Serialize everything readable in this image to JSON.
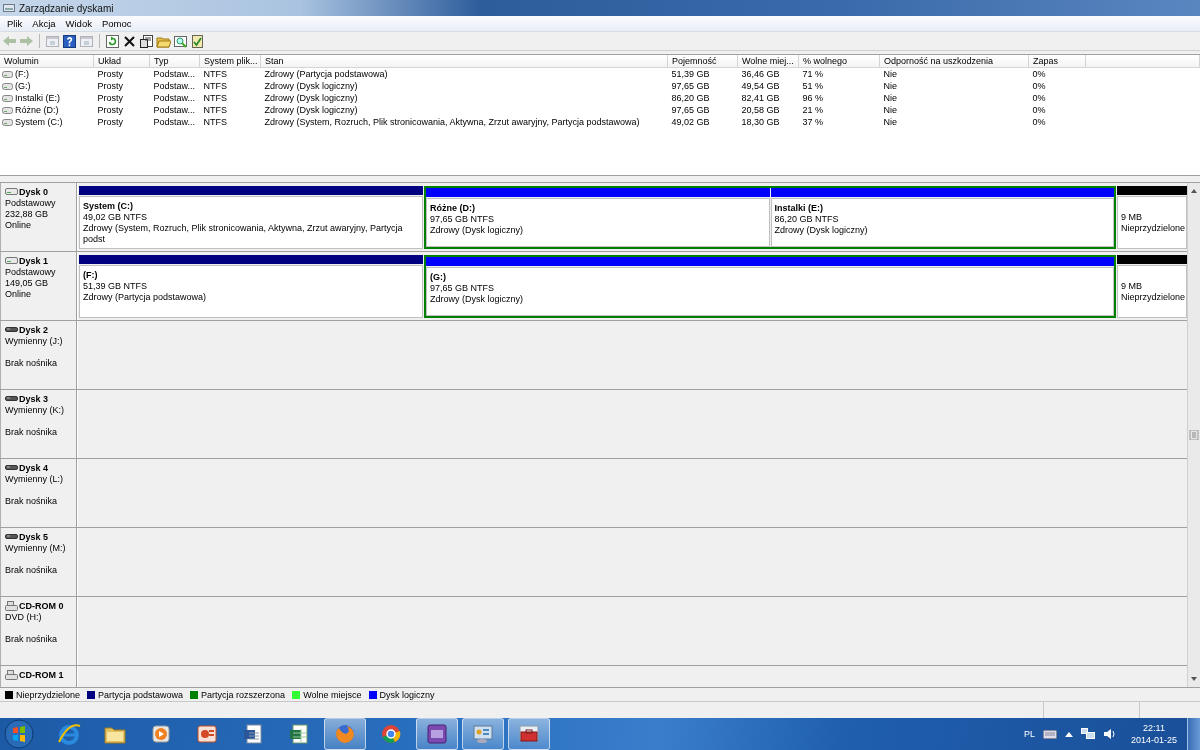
{
  "window": {
    "title": "Zarządzanie dyskami"
  },
  "menu": [
    "Plik",
    "Akcja",
    "Widok",
    "Pomoc"
  ],
  "toolbar": [
    {
      "kind": "back",
      "disabled": true
    },
    {
      "kind": "forward",
      "disabled": true
    },
    {
      "kind": "sep"
    },
    {
      "kind": "pane",
      "disabled": true
    },
    {
      "kind": "help",
      "disabled": false
    },
    {
      "kind": "pane",
      "disabled": true
    },
    {
      "kind": "sep"
    },
    {
      "kind": "refresh",
      "disabled": false
    },
    {
      "kind": "delete",
      "disabled": false
    },
    {
      "kind": "properties",
      "disabled": false
    },
    {
      "kind": "folder",
      "disabled": false
    },
    {
      "kind": "search",
      "disabled": false
    },
    {
      "kind": "check",
      "disabled": false
    }
  ],
  "volumes": {
    "columns": [
      "Wolumin",
      "Układ",
      "Typ",
      "System plik...",
      "Stan",
      "Pojemność",
      "Wolne miej...",
      "% wolnego",
      "Odporność na uszkodzenia",
      "Zapas"
    ],
    "rows": [
      [
        "(F:)",
        "Prosty",
        "Podstaw...",
        "NTFS",
        "Zdrowy (Partycja podstawowa)",
        "51,39 GB",
        "36,46 GB",
        "71 %",
        "Nie",
        "0%"
      ],
      [
        "(G:)",
        "Prosty",
        "Podstaw...",
        "NTFS",
        "Zdrowy (Dysk logiczny)",
        "97,65 GB",
        "49,54 GB",
        "51 %",
        "Nie",
        "0%"
      ],
      [
        "Instalki (E:)",
        "Prosty",
        "Podstaw...",
        "NTFS",
        "Zdrowy (Dysk logiczny)",
        "86,20 GB",
        "82,41 GB",
        "96 %",
        "Nie",
        "0%"
      ],
      [
        "Różne (D:)",
        "Prosty",
        "Podstaw...",
        "NTFS",
        "Zdrowy (Dysk logiczny)",
        "97,65 GB",
        "20,58 GB",
        "21 %",
        "Nie",
        "0%"
      ],
      [
        "System (C:)",
        "Prosty",
        "Podstaw...",
        "NTFS",
        "Zdrowy (System, Rozruch, Plik stronicowania, Aktywna, Zrzut awaryjny, Partycja podstawowa)",
        "49,02 GB",
        "18,30 GB",
        "37 %",
        "Nie",
        "0%"
      ]
    ]
  },
  "disks": [
    {
      "kind": "basic",
      "name": "Dysk 0",
      "type": "Podstawowy",
      "size": "232,88 GB",
      "status": "Online",
      "partitions": [
        {
          "kind": "primary",
          "name": "System  (C:)",
          "size": "49,02 GB NTFS",
          "status": "Zdrowy (System, Rozruch, Plik stronicowania, Aktywna, Zrzut awaryjny, Partycja podst"
        },
        {
          "kind": "extended",
          "children": [
            {
              "kind": "logical",
              "name": "Różne  (D:)",
              "size": "97,65 GB NTFS",
              "status": "Zdrowy (Dysk logiczny)"
            },
            {
              "kind": "logical",
              "name": "Instalki  (E:)",
              "size": "86,20 GB NTFS",
              "status": "Zdrowy (Dysk logiczny)"
            }
          ]
        },
        {
          "kind": "unallocated",
          "size": "9 MB",
          "status": "Nieprzydzielone"
        }
      ]
    },
    {
      "kind": "basic",
      "name": "Dysk 1",
      "type": "Podstawowy",
      "size": "149,05 GB",
      "status": "Online",
      "partitions": [
        {
          "kind": "primary",
          "name": "(F:)",
          "size": "51,39 GB NTFS",
          "status": "Zdrowy (Partycja podstawowa)"
        },
        {
          "kind": "extended",
          "children": [
            {
              "kind": "logical",
              "name": "(G:)",
              "size": "97,65 GB NTFS",
              "status": "Zdrowy (Dysk logiczny)"
            }
          ]
        },
        {
          "kind": "unallocated",
          "size": "9 MB",
          "status": "Nieprzydzielone"
        }
      ]
    },
    {
      "kind": "removable",
      "name": "Dysk 2",
      "type": "Wymienny (J:)",
      "status": "Brak nośnika"
    },
    {
      "kind": "removable",
      "name": "Dysk 3",
      "type": "Wymienny (K:)",
      "status": "Brak nośnika"
    },
    {
      "kind": "removable",
      "name": "Dysk 4",
      "type": "Wymienny (L:)",
      "status": "Brak nośnika"
    },
    {
      "kind": "removable",
      "name": "Dysk 5",
      "type": "Wymienny (M:)",
      "status": "Brak nośnika"
    },
    {
      "kind": "cdrom",
      "name": "CD-ROM 0",
      "type": "DVD (H:)",
      "status": "Brak nośnika"
    },
    {
      "kind": "cdrom",
      "name": "CD-ROM 1"
    }
  ],
  "legend": [
    {
      "label": "Nieprzydzielone",
      "color": "#000000"
    },
    {
      "label": "Partycja podstawowa",
      "color": "#000080"
    },
    {
      "label": "Partycja rozszerzona",
      "color": "#008000"
    },
    {
      "label": "Wolne miejsce",
      "color": "#33ff33"
    },
    {
      "label": "Dysk logiczny",
      "color": "#0000ff"
    }
  ],
  "taskbar": {
    "apps": [
      {
        "kind": "ie",
        "running": false
      },
      {
        "kind": "explorer",
        "running": false
      },
      {
        "kind": "media",
        "running": false
      },
      {
        "kind": "presentation",
        "running": false
      },
      {
        "kind": "word",
        "running": false
      },
      {
        "kind": "excel",
        "running": false
      },
      {
        "kind": "firefox",
        "running": true
      },
      {
        "kind": "chrome",
        "running": false
      },
      {
        "kind": "cpu",
        "running": true
      },
      {
        "kind": "control",
        "running": true
      },
      {
        "kind": "toolbox",
        "running": true
      }
    ],
    "language": "PL",
    "time": "22:11",
    "date": "2014-01-25"
  }
}
